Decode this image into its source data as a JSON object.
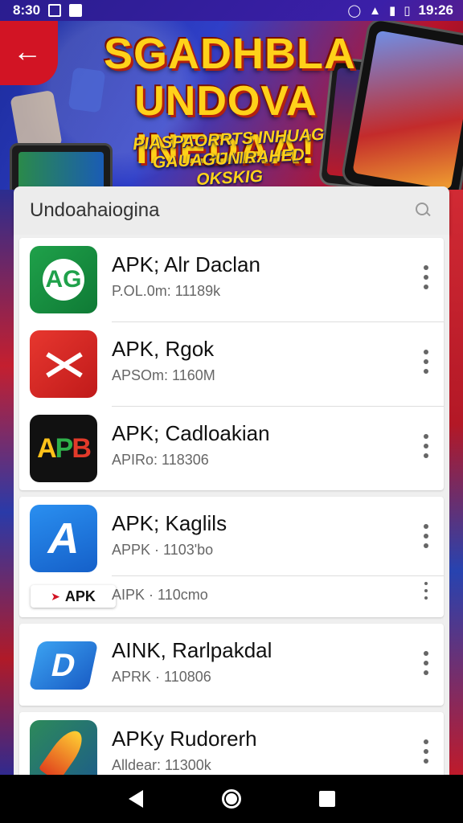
{
  "status_bar": {
    "time_left": "8:30",
    "time_right": "19:26"
  },
  "banner": {
    "title_line1": "SGADHBLA",
    "title_line2": "UNDOVA INEDAA!",
    "subtitle_line1": "PIASPAORRTS INHUAG GOMO",
    "subtitle_line2": "GAUAGUN RAHED OKSKIG"
  },
  "search": {
    "text": "Undoahaiogina"
  },
  "apps": [
    {
      "title": "APK; Alr Daclan",
      "meta": "P.OL.0m: 11189k",
      "icon": "ag-app-icon",
      "icon_text": "AG"
    },
    {
      "title": "APK, Rgok",
      "meta": "APSOm: 1160M",
      "icon": "red-x-app-icon"
    },
    {
      "title": "APK; Cadloakian",
      "meta": "APIRo: 118306",
      "icon": "apb-app-icon",
      "icon_text": [
        "A",
        "P",
        "B"
      ]
    },
    {
      "title": "APK; Kaglils",
      "meta": "APPK · 1103'bo",
      "icon": "blue-a-app-icon",
      "icon_text": "A",
      "badge_label": "APK",
      "sub_meta": "AIPK · 110cmo"
    },
    {
      "title": "AINK, Rarlpakdal",
      "meta": "APRK · 110806",
      "icon": "blue-d-app-icon",
      "icon_text": "D"
    },
    {
      "title": "APKy Rudorerh",
      "meta": "Alldear: 11300k",
      "icon": "feather-app-icon"
    }
  ],
  "colors": {
    "accent_red": "#d21424",
    "banner_yellow": "#ffd21a",
    "card_bg": "#ffffff"
  }
}
